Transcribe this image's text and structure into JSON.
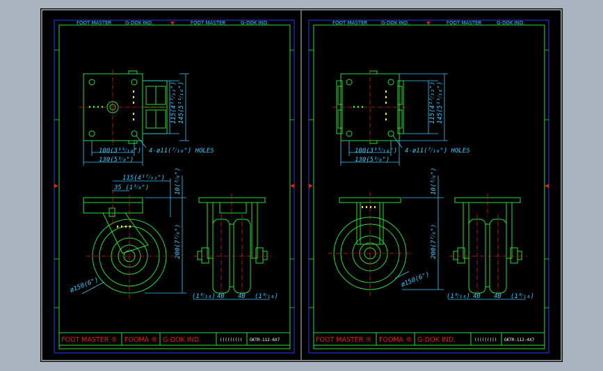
{
  "sheets": [
    {
      "header": [
        "FOOT MASTER",
        "G-DOK IND.",
        "FOOT MASTER",
        "G-DOK IND."
      ],
      "dims": {
        "d115v": "115(4¹⁷⁄₃₂\")",
        "d145v": "145(5¹¹⁄₁₆\")",
        "d100": "100(3¹⁵⁄₁₆\")",
        "d130": "130(5¹⁄₈\")",
        "holes": "4-ø11(⁷⁄₁₆\") HOLES",
        "d115h": "115(4¹⁷⁄₃₂\")",
        "d35": "35 (1³⁄₈\")",
        "d10": "10(³⁄₈\")",
        "d200": "200(7⁷⁄₈\")",
        "d150": "ø150(6\")",
        "w1": "(1⁹⁄₁₆)",
        "w2": "40",
        "w3": "40",
        "w4": "(1⁹⁄₁₆)"
      },
      "title_block": [
        "FOOT MASTER ®",
        "FOOMA ®",
        "G-DOK IND.",
        "(((((((((",
        "GKTR-112-6X7"
      ]
    },
    {
      "header": [
        "FOOT MASTER",
        "G-DOK IND.",
        "FOOT MASTER",
        "G-DOK IND."
      ],
      "dims": {
        "d115v": "115(4¹⁷⁄₃₂\")",
        "d145v": "145(5¹¹⁄₁₆\")",
        "d100": "100(3¹⁵⁄₁₆\")",
        "d130": "130(5¹⁄₈\")",
        "holes": "4-ø11(⁷⁄₁₆\") HOLES",
        "d10": "10(³⁄₈\")",
        "d200": "200(7⁷⁄₈\")",
        "d150": "ø150(6\")",
        "w1": "(1⁹⁄₁₆)",
        "w2": "40",
        "w3": "40",
        "w4": "(1⁹⁄₁₆)"
      },
      "title_block": [
        "FOOT MASTER ®",
        "FOOMA ®",
        "G-DOK IND.",
        "(((((((((",
        "GKTR-112-4X7"
      ]
    }
  ]
}
